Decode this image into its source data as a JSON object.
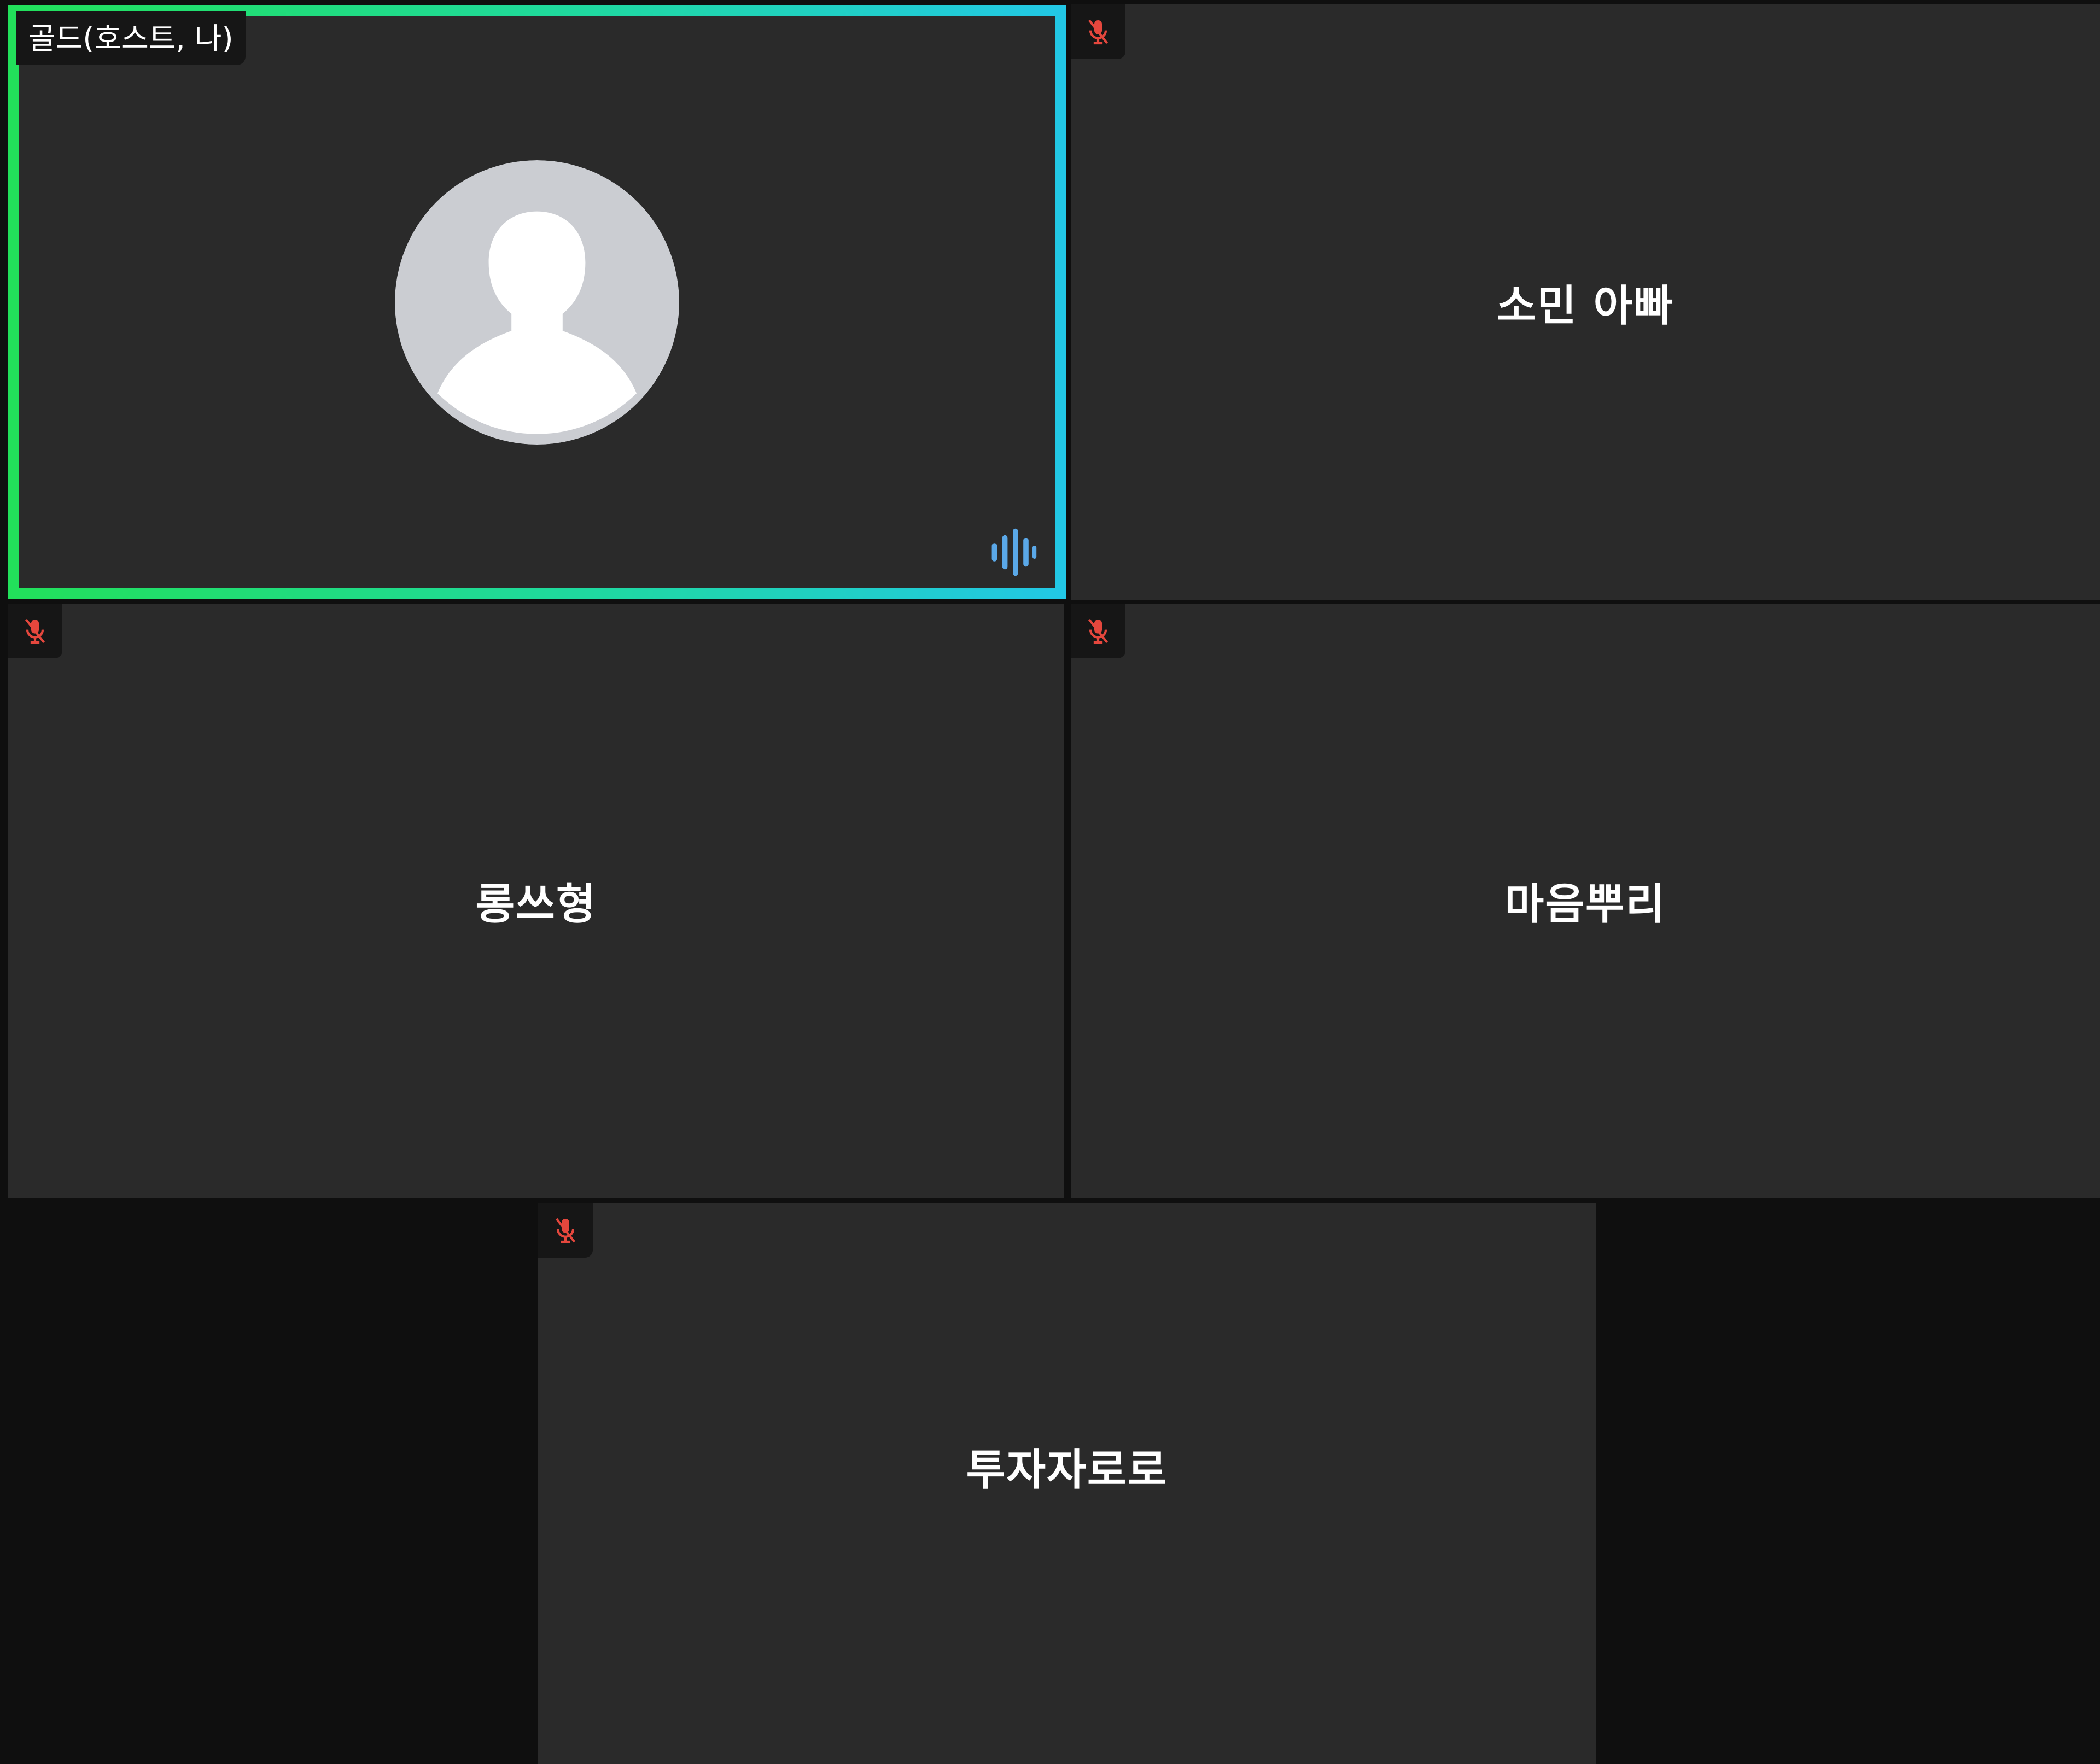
{
  "host": {
    "label": "골드(호스트, 나)",
    "avatar_icon": "default-person-avatar",
    "speaking_indicator_icon": "audio-wave-icon",
    "border_colors": [
      "#22e05a",
      "#22c7e6"
    ]
  },
  "participants": [
    {
      "name": "소민 아빠",
      "muted": true
    },
    {
      "name": "롱쓰형",
      "muted": true
    },
    {
      "name": "마음뿌리",
      "muted": true
    },
    {
      "name": "투자자로로",
      "muted": true
    }
  ],
  "colors": {
    "tile_background": "#2a2a2a",
    "page_background": "#0f0f0f",
    "muted_icon": "#e5473d",
    "speaking_indicator": "#5aa8e8"
  }
}
